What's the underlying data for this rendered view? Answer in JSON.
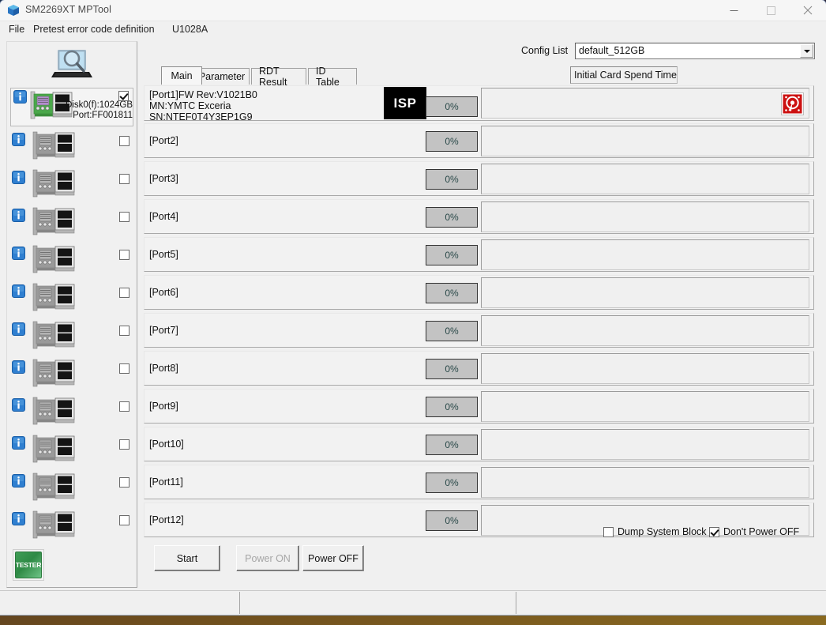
{
  "window": {
    "title": "SM2269XT MPTool",
    "icon": "cube-icon",
    "controls": {
      "minimize": "minimize-icon",
      "maximize": "maximize-icon",
      "close": "close-icon"
    }
  },
  "menu": {
    "items": [
      {
        "label": "File"
      },
      {
        "label": "Pretest error code definition"
      },
      {
        "label": "U1028A"
      }
    ]
  },
  "sidebar": {
    "scan_icon": "laptop-magnifier-icon",
    "tester_button": {
      "label": "TESTER"
    },
    "devices": [
      {
        "info_icon": "info-icon",
        "card_icon": "pcie-card-icon-active",
        "line1": "Disk0(f):1024GB",
        "line2": "Port:FF001811",
        "checked": true
      },
      {
        "info_icon": "info-icon",
        "card_icon": "pcie-card-icon",
        "line1": "",
        "line2": "",
        "checked": false
      },
      {
        "info_icon": "info-icon",
        "card_icon": "pcie-card-icon",
        "line1": "",
        "line2": "",
        "checked": false
      },
      {
        "info_icon": "info-icon",
        "card_icon": "pcie-card-icon",
        "line1": "",
        "line2": "",
        "checked": false
      },
      {
        "info_icon": "info-icon",
        "card_icon": "pcie-card-icon",
        "line1": "",
        "line2": "",
        "checked": false
      },
      {
        "info_icon": "info-icon",
        "card_icon": "pcie-card-icon",
        "line1": "",
        "line2": "",
        "checked": false
      },
      {
        "info_icon": "info-icon",
        "card_icon": "pcie-card-icon",
        "line1": "",
        "line2": "",
        "checked": false
      },
      {
        "info_icon": "info-icon",
        "card_icon": "pcie-card-icon",
        "line1": "",
        "line2": "",
        "checked": false
      },
      {
        "info_icon": "info-icon",
        "card_icon": "pcie-card-icon",
        "line1": "",
        "line2": "",
        "checked": false
      },
      {
        "info_icon": "info-icon",
        "card_icon": "pcie-card-icon",
        "line1": "",
        "line2": "",
        "checked": false
      },
      {
        "info_icon": "info-icon",
        "card_icon": "pcie-card-icon",
        "line1": "",
        "line2": "",
        "checked": false
      },
      {
        "info_icon": "info-icon",
        "card_icon": "pcie-card-icon",
        "line1": "",
        "line2": "",
        "checked": false
      }
    ]
  },
  "config": {
    "label": "Config List",
    "selected": "default_512GB",
    "options": [
      "default_512GB"
    ]
  },
  "tabs": [
    {
      "label": "Main",
      "active": true
    },
    {
      "label": "Parameter",
      "active": false
    },
    {
      "label": "RDT Result",
      "active": false
    },
    {
      "label": "ID Table",
      "active": false
    }
  ],
  "spend_time_label": "Initial Card Spend Time",
  "ports": [
    {
      "label": "[Port1]FW Rev:V1021B0\nMN:YMTC Exceria\nSN:NTEF0T4Y3EP1G9",
      "badge": "ISP",
      "progress": "0%",
      "has_badge": true,
      "has_drive_icon": true
    },
    {
      "label": "[Port2]",
      "badge": "",
      "progress": "0%",
      "has_badge": false,
      "has_drive_icon": false
    },
    {
      "label": "[Port3]",
      "badge": "",
      "progress": "0%",
      "has_badge": false,
      "has_drive_icon": false
    },
    {
      "label": "[Port4]",
      "badge": "",
      "progress": "0%",
      "has_badge": false,
      "has_drive_icon": false
    },
    {
      "label": "[Port5]",
      "badge": "",
      "progress": "0%",
      "has_badge": false,
      "has_drive_icon": false
    },
    {
      "label": "[Port6]",
      "badge": "",
      "progress": "0%",
      "has_badge": false,
      "has_drive_icon": false
    },
    {
      "label": "[Port7]",
      "badge": "",
      "progress": "0%",
      "has_badge": false,
      "has_drive_icon": false
    },
    {
      "label": "[Port8]",
      "badge": "",
      "progress": "0%",
      "has_badge": false,
      "has_drive_icon": false
    },
    {
      "label": "[Port9]",
      "badge": "",
      "progress": "0%",
      "has_badge": false,
      "has_drive_icon": false
    },
    {
      "label": "[Port10]",
      "badge": "",
      "progress": "0%",
      "has_badge": false,
      "has_drive_icon": false
    },
    {
      "label": "[Port11]",
      "badge": "",
      "progress": "0%",
      "has_badge": false,
      "has_drive_icon": false
    },
    {
      "label": "[Port12]",
      "badge": "",
      "progress": "0%",
      "has_badge": false,
      "has_drive_icon": false
    }
  ],
  "buttons": {
    "start": "Start",
    "power_on": "Power ON",
    "power_on_disabled": true,
    "power_off": "Power OFF"
  },
  "checkboxes": {
    "dump_system_block": {
      "label": "Dump System Block",
      "checked": false
    },
    "dont_power_off": {
      "label": "Don't Power OFF",
      "checked": true
    }
  },
  "statusbar": {
    "panels": [
      "",
      "",
      ""
    ]
  },
  "colors": {
    "window_bg": "#f0f0f0",
    "badge_bg": "#000000",
    "progress_bg": "#c3c3c3",
    "tester_green": "#3f9d56",
    "drive_red": "#cc1111",
    "info_blue": "#2f7fd0"
  }
}
